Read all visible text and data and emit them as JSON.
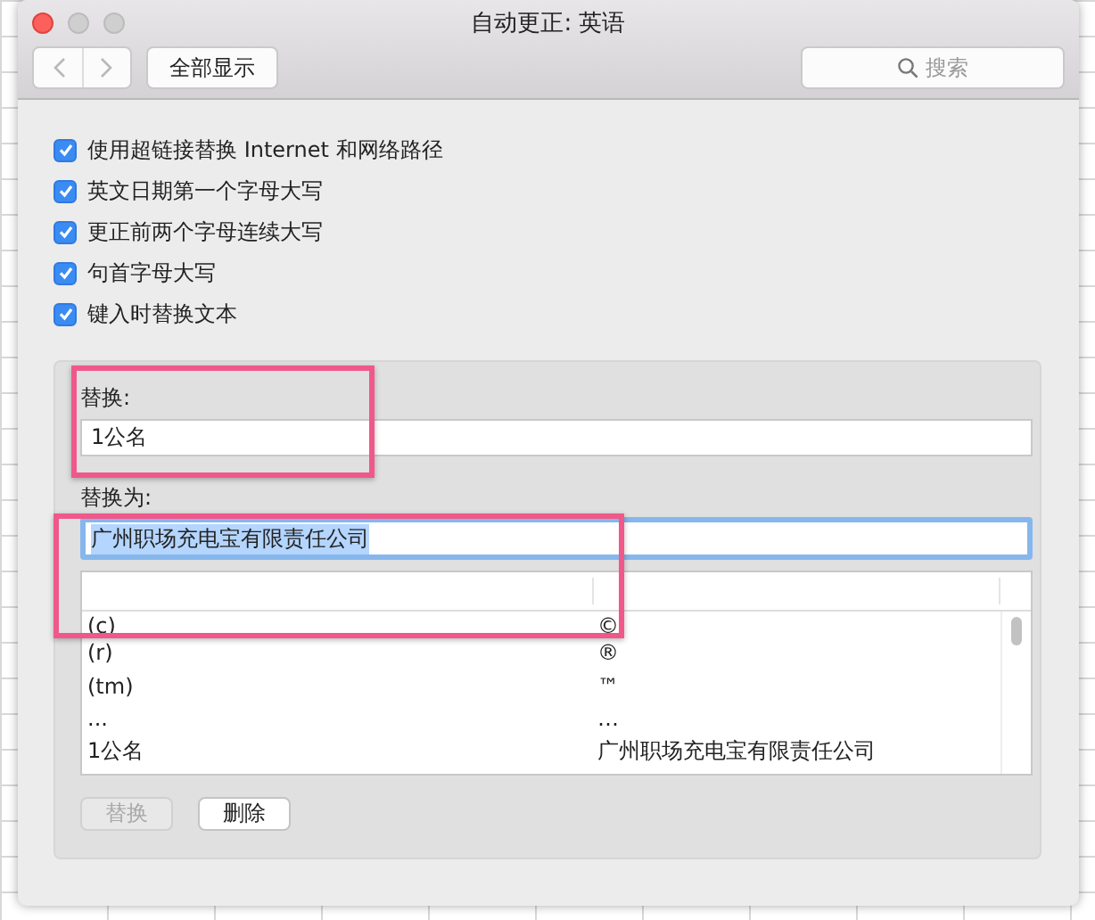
{
  "window": {
    "title": "自动更正: 英语"
  },
  "toolbar": {
    "show_all_button": "全部显示",
    "search": {
      "placeholder": "搜索"
    }
  },
  "options": [
    {
      "label": "使用超链接替换 Internet 和网络路径",
      "checked": true
    },
    {
      "label": "英文日期第一个字母大写",
      "checked": true
    },
    {
      "label": "更正前两个字母连续大写",
      "checked": true
    },
    {
      "label": "句首字母大写",
      "checked": true
    },
    {
      "label": "键入时替换文本",
      "checked": true
    }
  ],
  "replace": {
    "label": "替换:",
    "value": "1公名"
  },
  "replace_with": {
    "label": "替换为:",
    "value": "广州职场充电宝有限责任公司",
    "focused": true,
    "text_selected": true
  },
  "table": {
    "rows": [
      {
        "from": "(c)",
        "to": "©"
      },
      {
        "from": "(r)",
        "to": "®"
      },
      {
        "from": "(tm)",
        "to": "™"
      },
      {
        "from": "...",
        "to": "…"
      },
      {
        "from": "1公名",
        "to": "广州职场充电宝有限责任公司"
      }
    ]
  },
  "buttons": [
    {
      "label": "替换",
      "disabled": true
    },
    {
      "label": "删除",
      "disabled": false
    }
  ]
}
